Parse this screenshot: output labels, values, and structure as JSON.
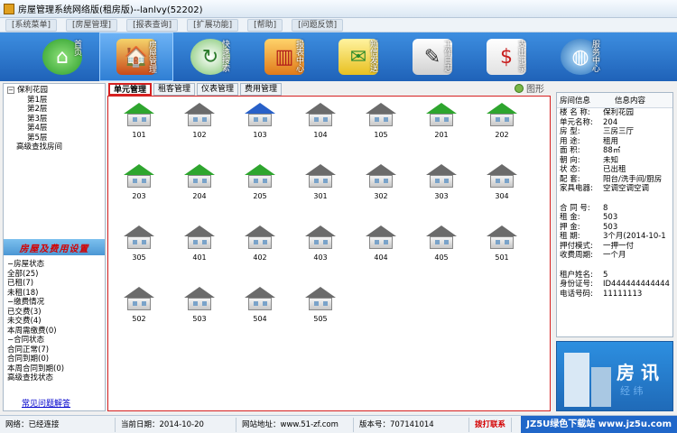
{
  "window": {
    "title": "房屋管理系统网络版(租房版)--lanlvy(52202)"
  },
  "menubar": [
    "[系统菜单]",
    "[房屋管理]",
    "[报表查询]",
    "[扩展功能]",
    "[帮助]",
    "[问题反馈]"
  ],
  "toolbar": [
    {
      "label": "首页",
      "icon": "home-icon"
    },
    {
      "label": "房屋管理",
      "icon": "house-icon"
    },
    {
      "label": "快速搜索",
      "icon": "refresh-icon"
    },
    {
      "label": "报表中心",
      "icon": "chart-icon"
    },
    {
      "label": "短信发送",
      "icon": "envelope-icon"
    },
    {
      "label": "工作日志",
      "icon": "notebook-icon"
    },
    {
      "label": "支出记录",
      "icon": "expense-icon"
    },
    {
      "label": "服务中心",
      "icon": "globe-icon"
    }
  ],
  "tree": {
    "root": "保利花园",
    "floors": [
      "第1层",
      "第2层",
      "第3层",
      "第4层",
      "第5层"
    ],
    "advanced": "高级查找房间"
  },
  "section_title": "房屋及费用设置",
  "tree2": {
    "house_status": "房屋状态",
    "status_items": [
      "全部(25)",
      "已租(7)",
      "未租(18)"
    ],
    "payment": "缴费情况",
    "payment_items": [
      "已交费(3)",
      "未交费(4)",
      "本周需缴费(0)"
    ],
    "contract": "合同状态",
    "contract_items": [
      "合同正常(7)",
      "合同到期(0)",
      "本周合同到期(0)"
    ],
    "advanced_status": "高级查找状态"
  },
  "help_link": "常见问题解答",
  "tabs": [
    "单元管理",
    "租客管理",
    "仪表管理",
    "费用管理"
  ],
  "graph_label": "图形",
  "rooms": [
    {
      "n": "101",
      "c": "green"
    },
    {
      "n": "102",
      "c": "gray"
    },
    {
      "n": "103",
      "c": "blue"
    },
    {
      "n": "104",
      "c": "gray"
    },
    {
      "n": "105",
      "c": "gray"
    },
    {
      "n": "201",
      "c": "green"
    },
    {
      "n": "202",
      "c": "green"
    },
    {
      "n": "203",
      "c": "green"
    },
    {
      "n": "204",
      "c": "green"
    },
    {
      "n": "205",
      "c": "green"
    },
    {
      "n": "301",
      "c": "gray"
    },
    {
      "n": "302",
      "c": "gray"
    },
    {
      "n": "303",
      "c": "gray"
    },
    {
      "n": "304",
      "c": "gray"
    },
    {
      "n": "305",
      "c": "gray"
    },
    {
      "n": "401",
      "c": "gray"
    },
    {
      "n": "402",
      "c": "gray"
    },
    {
      "n": "403",
      "c": "gray"
    },
    {
      "n": "404",
      "c": "gray"
    },
    {
      "n": "405",
      "c": "gray"
    },
    {
      "n": "501",
      "c": "gray"
    },
    {
      "n": "502",
      "c": "gray"
    },
    {
      "n": "503",
      "c": "gray"
    },
    {
      "n": "504",
      "c": "gray"
    },
    {
      "n": "505",
      "c": "gray"
    }
  ],
  "info": {
    "head_k": "房间信息",
    "head_v": "信息内容",
    "rows1": [
      [
        "楼 名 称:",
        "保利花园"
      ],
      [
        "单元名称:",
        "204"
      ],
      [
        "房    型:",
        "三房三厅"
      ],
      [
        "用    途:",
        "租用"
      ],
      [
        "面    积:",
        "88㎡"
      ],
      [
        "朝    向:",
        "未知"
      ],
      [
        "状    态:",
        "已出租"
      ],
      [
        "配    套:",
        "阳台/洗手间/厨房"
      ],
      [
        "家具电器:",
        "空调空调空调"
      ]
    ],
    "rows2": [
      [
        "合 同 号:",
        "8"
      ],
      [
        "租    金:",
        "503"
      ],
      [
        "押    金:",
        "503"
      ],
      [
        "租    期:",
        "3个月(2014-10-1"
      ],
      [
        "押付模式:",
        "一押一付"
      ],
      [
        "收费周期:",
        "一个月"
      ]
    ],
    "rows3": [
      [
        "租户姓名:",
        "5"
      ],
      [
        "身份证号:",
        "ID444444444444"
      ],
      [
        "电话号码:",
        "11111113"
      ]
    ]
  },
  "ad": {
    "title": "房 讯",
    "sub": "经 纬"
  },
  "status": {
    "network": "网络：已经连接",
    "date": "当前日期：2014-10-20",
    "website": "网站地址：www.51-zf.com",
    "version": "版本号：707141014",
    "phone": "拨打联系",
    "watermark": "JZ5U绿色下载站 www.jz5u.com"
  }
}
